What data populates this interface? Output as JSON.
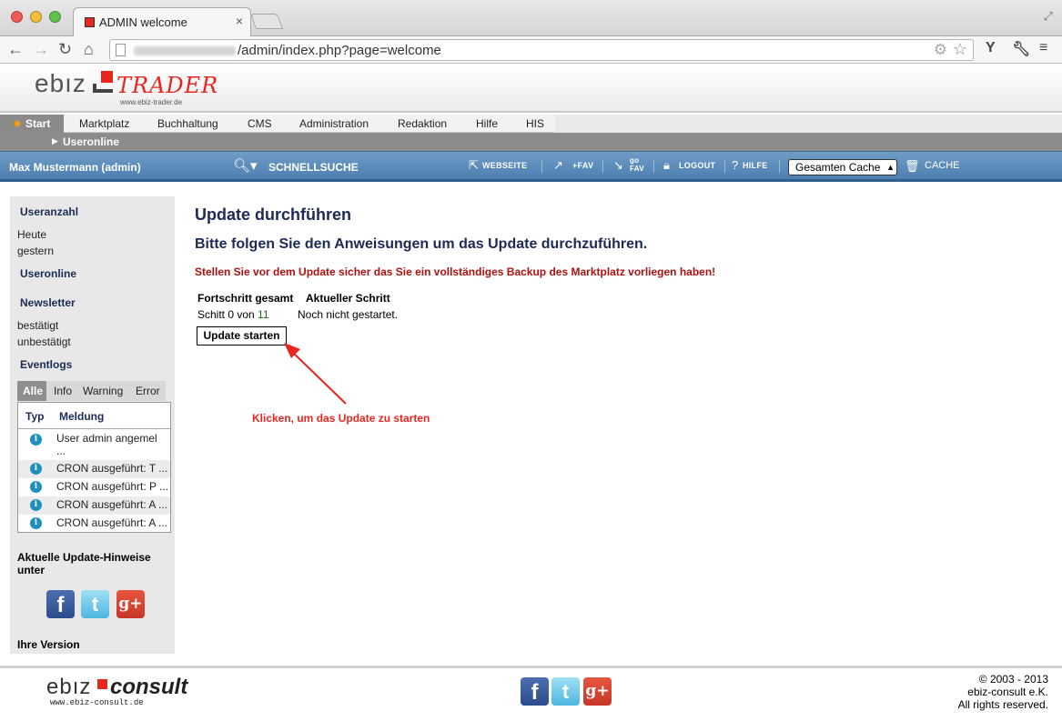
{
  "browser": {
    "tab_title": "ADMIN welcome",
    "tab_close": "×",
    "url_path": "/admin/index.php?page=welcome",
    "toolbar_y": "Y"
  },
  "logo": {
    "ebiz": "ebız",
    "trader": "TRADER",
    "url": "www.ebiz-trader.de"
  },
  "mainnav": {
    "items": [
      {
        "label": "Start"
      },
      {
        "label": "Marktplatz"
      },
      {
        "label": "Buchhaltung"
      },
      {
        "label": "CMS"
      },
      {
        "label": "Administration"
      },
      {
        "label": "Redaktion"
      },
      {
        "label": "Hilfe"
      },
      {
        "label": "HIS"
      }
    ],
    "sub_item": "Useronline"
  },
  "adminbar": {
    "user": "Max Mustermann (admin)",
    "search": "SCHNELLSUCHE",
    "webseite": "WEBSEITE",
    "plus_fav": "+FAV",
    "go_fav_top": "go",
    "go_fav_bottom": "FAV",
    "logout": "LOGOUT",
    "hilfe": "HILFE",
    "cache_select": "Gesamten Cache",
    "cache": "CACHE"
  },
  "sidebar": {
    "useranzahl": "Useranzahl",
    "heute": "Heute",
    "gestern": "gestern",
    "useronline": "Useronline",
    "newsletter": "Newsletter",
    "bestaetigt": "bestätigt",
    "unbestaetigt": "unbestätigt",
    "eventlogs": "Eventlogs",
    "tabs": [
      "Alle",
      "Info",
      "Warning",
      "Error"
    ],
    "col_typ": "Typ",
    "col_meldung": "Meldung",
    "log_rows": [
      {
        "msg": "User admin angemel",
        "msg2": "..."
      },
      {
        "msg": "CRON ausgeführt: T ..."
      },
      {
        "msg": "CRON ausgeführt: P ..."
      },
      {
        "msg": "CRON ausgeführt: A ..."
      },
      {
        "msg": "CRON ausgeführt: A ..."
      }
    ],
    "update_hint_line1": "Aktuelle Update-Hinweise",
    "update_hint_line2": "unter",
    "version": "Ihre Version"
  },
  "social": {
    "facebook": "f",
    "twitter": "t",
    "googleplus": "g+"
  },
  "content": {
    "title": "Update durchführen",
    "subtitle": "Bitte folgen Sie den Anweisungen um das Update durchzuführen.",
    "warning": "Stellen Sie vor dem Update sicher das Sie ein vollständiges Backup des Marktplatz vorliegen haben!",
    "col_progress": "Fortschritt gesamt",
    "col_step": "Aktueller Schritt",
    "progress_prefix": "Schitt 0 von ",
    "progress_total": "11",
    "step_status": "Noch nicht gestartet.",
    "button": "Update starten",
    "annotation": "Klicken, um das Update zu starten"
  },
  "footer": {
    "ebiz": "ebız",
    "consult": "consult",
    "url": "www.ebiz-consult.de",
    "copyright": "© 2003 - 2013",
    "company": "ebiz-consult e.K.",
    "rights": "All rights reserved."
  },
  "colors": {
    "accent_red": "#e8261d",
    "admin_bar_blue": "#4d7fb0",
    "heading_navy": "#1c2a55",
    "warning_red": "#b01010"
  }
}
